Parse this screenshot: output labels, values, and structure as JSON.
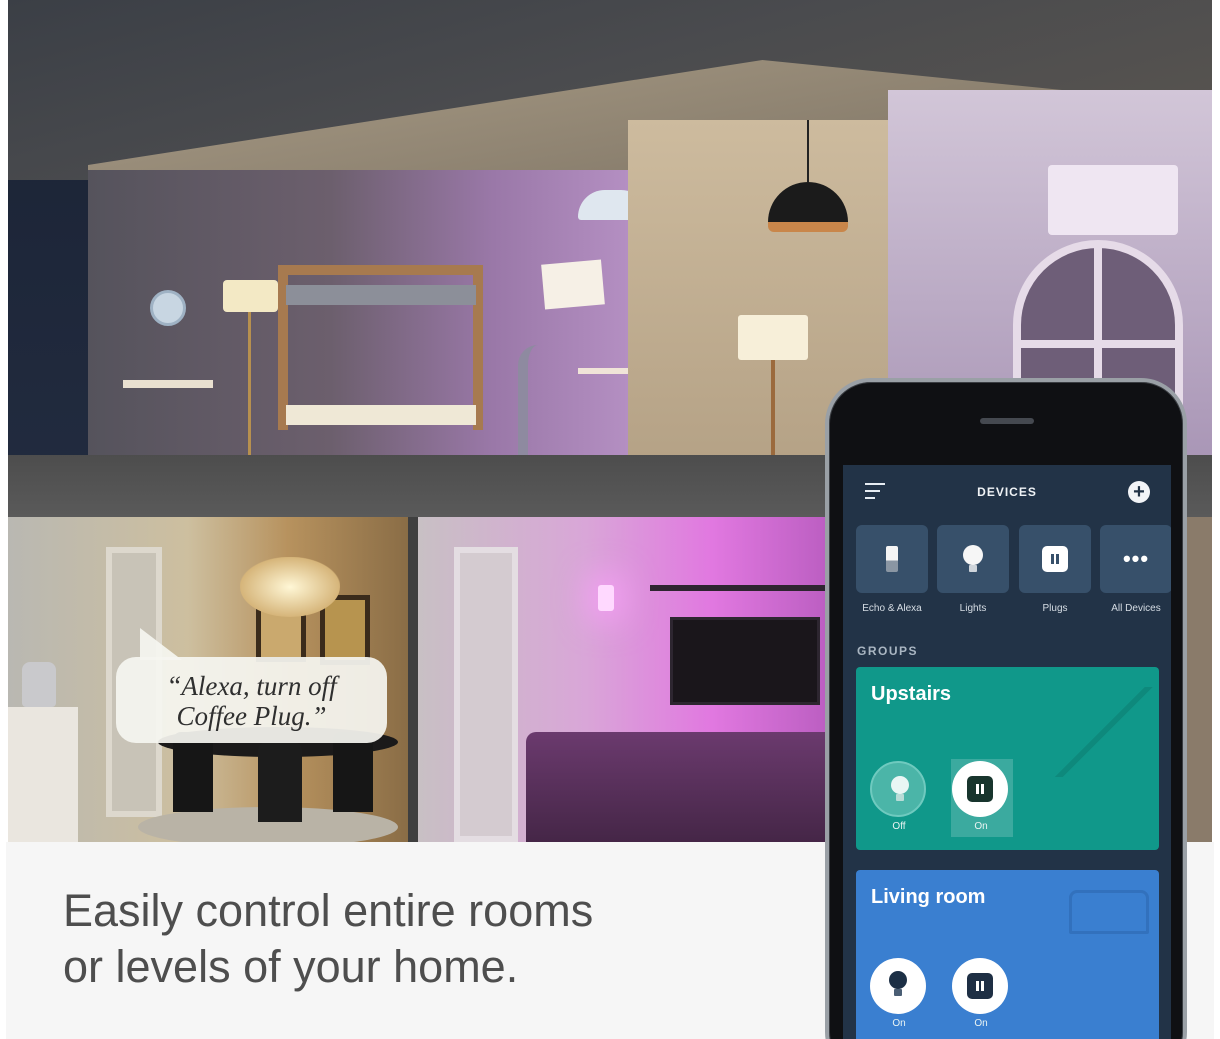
{
  "scene": {
    "speech_bubble": {
      "line1": "“Alexa, turn off",
      "line2": "Coffee Plug.”"
    }
  },
  "caption": {
    "line1": "Easily control entire rooms",
    "line2": "or levels of your home."
  },
  "app": {
    "header": {
      "title": "DEVICES",
      "menu_icon": "menu-icon",
      "add_icon": "plus-circle-icon",
      "add_glyph": "+"
    },
    "categories": [
      {
        "label": "Echo & Alexa",
        "icon": "echo-icon"
      },
      {
        "label": "Lights",
        "icon": "bulb-icon"
      },
      {
        "label": "Plugs",
        "icon": "plug-icon"
      },
      {
        "label": "All Devices",
        "icon": "more-icon",
        "glyph": "•••"
      }
    ],
    "groups_label": "GROUPS",
    "groups": [
      {
        "name": "Upstairs",
        "color": "#10988a",
        "devices": [
          {
            "type": "light",
            "state": "Off"
          },
          {
            "type": "plug",
            "state": "On"
          }
        ]
      },
      {
        "name": "Living room",
        "color": "#3a7fd0",
        "devices": [
          {
            "type": "light",
            "state": "On"
          },
          {
            "type": "plug",
            "state": "On"
          }
        ]
      }
    ]
  },
  "colors": {
    "app_background": "#223347",
    "tile": "#37506a",
    "caption_text": "#4e4e4e"
  }
}
